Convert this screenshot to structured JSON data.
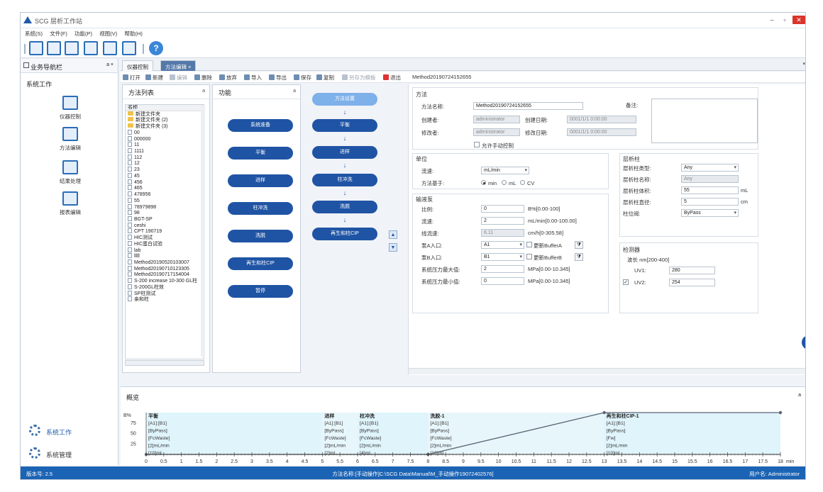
{
  "window": {
    "title": "SCG 层析工作站"
  },
  "menu": [
    "系统(S)",
    "文件(F)",
    "功能(P)",
    "视图(V)",
    "帮助(H)"
  ],
  "nav": {
    "title": "业务导航栏",
    "pin": "a ×",
    "section": "系统工作",
    "items": [
      "仪器控制",
      "方法编辑",
      "结果处理",
      "报表编辑"
    ],
    "bottom": [
      "系统工作",
      "系统管理"
    ]
  },
  "tabs": [
    {
      "label": "仪器控制"
    },
    {
      "label": "方法编辑 ×"
    }
  ],
  "subtoolbar": {
    "items": [
      "打开",
      "新建",
      "编辑",
      "删除",
      "放弃",
      "导入",
      "导出",
      "保存",
      "复制",
      "另存为模板",
      "退出"
    ],
    "method_id": "Method20190724152655"
  },
  "method_list": {
    "title": "方法列表",
    "pin": "a",
    "header": "名称",
    "items": [
      {
        "name": "新建文件夹",
        "type": "folder"
      },
      {
        "name": "新建文件夹 (2)",
        "type": "folder"
      },
      {
        "name": "新建文件夹 (3)",
        "type": "folder"
      },
      {
        "name": "00",
        "type": "doc"
      },
      {
        "name": "000000",
        "type": "doc"
      },
      {
        "name": "11",
        "type": "doc"
      },
      {
        "name": "1111",
        "type": "doc"
      },
      {
        "name": "112",
        "type": "doc"
      },
      {
        "name": "12",
        "type": "doc"
      },
      {
        "name": "23",
        "type": "doc"
      },
      {
        "name": "45",
        "type": "doc"
      },
      {
        "name": "456",
        "type": "doc"
      },
      {
        "name": "465",
        "type": "doc"
      },
      {
        "name": "478956",
        "type": "doc"
      },
      {
        "name": "55",
        "type": "doc"
      },
      {
        "name": "78979898",
        "type": "doc"
      },
      {
        "name": "98",
        "type": "doc"
      },
      {
        "name": "BGT-SP",
        "type": "doc"
      },
      {
        "name": "ceshi",
        "type": "doc"
      },
      {
        "name": "CPT 190719",
        "type": "doc"
      },
      {
        "name": "HIC测试",
        "type": "doc"
      },
      {
        "name": "HIC蛋白试验",
        "type": "doc"
      },
      {
        "name": "lab",
        "type": "doc"
      },
      {
        "name": "lllll",
        "type": "doc"
      },
      {
        "name": "Method20190520103007",
        "type": "doc"
      },
      {
        "name": "Method20190710123305",
        "type": "doc"
      },
      {
        "name": "Method20190717154004",
        "type": "doc"
      },
      {
        "name": "S-200 increase 10-300 GL柱",
        "type": "doc"
      },
      {
        "name": "S-200GL柱效",
        "type": "doc"
      },
      {
        "name": "SP柱测试",
        "type": "doc"
      },
      {
        "name": "亲和柱",
        "type": "doc"
      }
    ]
  },
  "function_panel": {
    "title": "功能",
    "pin": "a",
    "items": [
      "系统准备",
      "平衡",
      "进样",
      "柱冲洗",
      "洗脱",
      "再生和柱CIP",
      "暂停"
    ]
  },
  "steps": [
    "方法设置",
    "平衡",
    "进样",
    "柱冲洗",
    "洗脱",
    "再生和柱CIP"
  ],
  "method": {
    "section": "方法",
    "name_label": "方法名称:",
    "name_value": "Method20190724152655",
    "note_label": "备注:",
    "creator_label": "创建者:",
    "creator_value": "administrator",
    "created_label": "创建日期:",
    "created_value": "0001/1/1 0:00:00",
    "modifier_label": "修改者:",
    "modifier_value": "administrator",
    "modified_label": "修改日期:",
    "modified_value": "0001/1/1 0:00:00",
    "manual_label": "允许手动控制"
  },
  "unit": {
    "section": "单位",
    "flow_label": "流速:",
    "flow_value": "mL/min",
    "base_label": "方法基于:",
    "options": [
      "min",
      "mL",
      "CV"
    ]
  },
  "pump": {
    "section": "输液泵",
    "ratio_label": "比例:",
    "ratio_value": "0",
    "ratio_unit": "B%[0.00-100]",
    "flow_label": "流速:",
    "flow_value": "2",
    "flow_unit": "mL/min[0.00-100.00]",
    "linear_label": "线流速:",
    "linear_value": "6.11",
    "linear_unit": "cm/h[0-305.58]",
    "a_label": "泵A入口:",
    "a_value": "A1",
    "a_buffer": "更新BufferA",
    "b_label": "泵B入口:",
    "b_value": "B1",
    "b_buffer": "更新BufferB",
    "pmax_label": "系统压力最大值:",
    "pmax_value": "2",
    "pmax_unit": "MPa[0.00-10.345]",
    "pmin_label": "系统压力最小值:",
    "pmin_value": "0",
    "pmin_unit": "MPa[0.00-10.345]"
  },
  "column": {
    "section": "层析柱",
    "type_label": "层析柱类型:",
    "type_value": "Any",
    "name_label": "层析柱名称:",
    "name_value": "Any",
    "volume_label": "层析柱体积:",
    "volume_value": "55",
    "volume_unit": "mL",
    "diameter_label": "层析柱直径:",
    "diameter_value": "5",
    "diameter_unit": "cm",
    "valve_label": "柱位阀:",
    "valve_value": "ByPass"
  },
  "detector": {
    "section": "检测器",
    "wavelength_label": "波长 nm[200-400]",
    "uv1_label": "UV1:",
    "uv1_value": "280",
    "uv2_label": "UV2:",
    "uv2_value": "254"
  },
  "overview": {
    "title": "概览",
    "pin": "a",
    "y_axis_label": "B%",
    "x_unit": "min",
    "y_ticks": [
      "75",
      "50",
      "25"
    ],
    "x_min": 0,
    "x_max": 18,
    "x_step": 0.5,
    "segments": [
      {
        "name": "平衡",
        "start": 0,
        "end": 5,
        "lines": [
          "[A1]:[B1]",
          "[ByPass]",
          "[FcWaste]",
          "[2]mL/min",
          "[10]mL"
        ],
        "color": "#dff4fb"
      },
      {
        "name": "进样",
        "start": 5,
        "end": 6,
        "lines": [
          "[A1]:[B1]",
          "[ByPass]",
          "[FcWaste]",
          "[2]mL/min",
          "[2]mL"
        ],
        "color": "#e7f6fb"
      },
      {
        "name": "柱冲洗",
        "start": 6,
        "end": 8,
        "lines": [
          "[A1]:[B1]",
          "[ByPass]",
          "[FcWaste]",
          "[2]mL/min",
          "[4]mL"
        ],
        "color": "#dff4fb"
      },
      {
        "name": "洗脱-1",
        "start": 8,
        "end": 13,
        "lines": [
          "[A1]:[B1]",
          "[ByPass]",
          "[FcWaste]",
          "[2]mL/min",
          "[10]mL"
        ],
        "color": "#e7f6fb"
      },
      {
        "name": "再生和柱CIP-1",
        "start": 13,
        "end": 18,
        "lines": [
          "[A1]:[B1]",
          "[ByPass]",
          "[Fw]",
          "[2]mL/min",
          "[10]mL"
        ],
        "color": "#dff4fb"
      }
    ],
    "gradient": [
      [
        0,
        0
      ],
      [
        8,
        0
      ],
      [
        13,
        100
      ],
      [
        18,
        100
      ]
    ]
  },
  "status": {
    "version": "版本号: 2.5",
    "path": "方法名称:[手动操作]C:\\SCG Data\\Manual\\M_手动操作19072402576]",
    "user": "用户名:  Administrator"
  }
}
